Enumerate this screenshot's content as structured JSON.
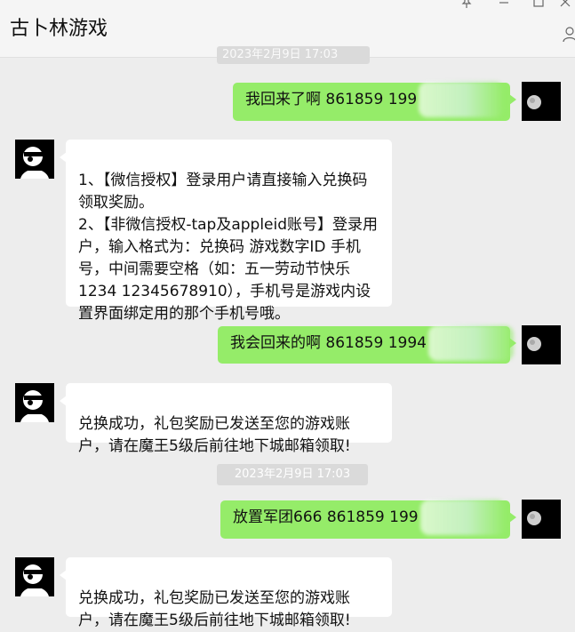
{
  "window": {
    "title": "古卜林游戏",
    "pin_icon": "pin-icon",
    "minimize_icon": "minimize-icon",
    "maximize_icon": "maximize-icon",
    "close_icon": "close-icon",
    "profile_icon": "user-icon"
  },
  "colors": {
    "outgoing_bubble": "#95ec69",
    "incoming_bubble": "#ffffff",
    "background": "#ededed",
    "timestamp_bg": "#dadada"
  },
  "messages": [
    {
      "direction": "out",
      "text": "我回来了啊 861859 199"
    },
    {
      "direction": "in",
      "text": "1、【微信授权】登录用户请直接输入兑换码领取奖励。\n2、【非微信授权-tap及appleid账号】登录用户，输入格式为：兑换码 游戏数字ID 手机号，中间需要空格（如：五一劳动节快乐 1234 12345678910），手机号是游戏内设置界面绑定用的那个手机号哦。"
    },
    {
      "direction": "out",
      "text": "我会回来的啊 861859 1994"
    },
    {
      "direction": "in",
      "text": "兑换成功，礼包奖励已发送至您的游戏账户，请在魔王5级后前往地下城邮箱领取!"
    },
    {
      "direction": "out",
      "text": "放置军团666 861859 199"
    },
    {
      "direction": "in",
      "text": "兑换成功，礼包奖励已发送至您的游戏账户，请在魔王5级后前往地下城邮箱领取!"
    }
  ],
  "timestamps": {
    "top_partial": "2023年2月9日 17:03",
    "main": "2023年2月9日  17:03"
  }
}
